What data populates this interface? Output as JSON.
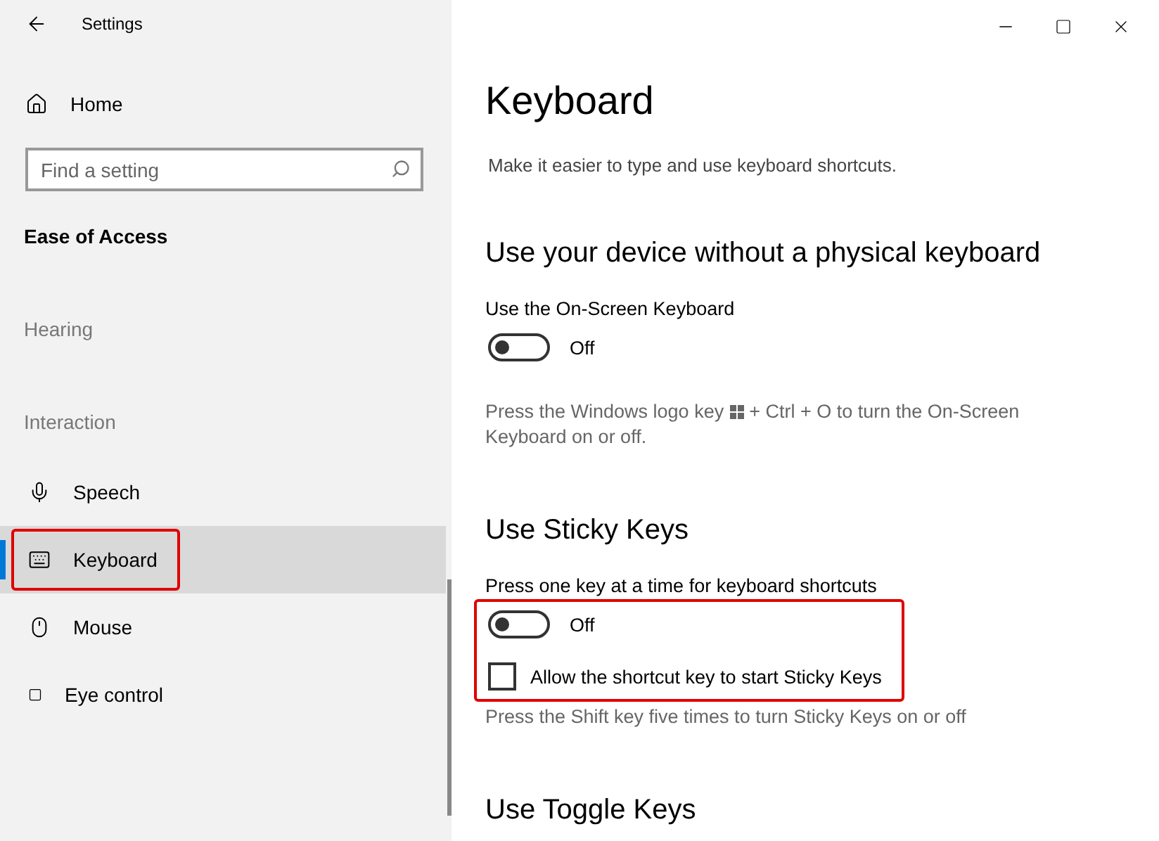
{
  "window": {
    "title": "Settings"
  },
  "sidebar": {
    "home": "Home",
    "search": {
      "placeholder": "Find a setting"
    },
    "section": "Ease of Access",
    "items": [
      {
        "kind": "header",
        "label": "Hearing"
      },
      {
        "kind": "header",
        "label": "Interaction"
      },
      {
        "kind": "item",
        "label": "Speech",
        "selected": false,
        "highlighted": false
      },
      {
        "kind": "item",
        "label": "Keyboard",
        "selected": true,
        "highlighted": true
      },
      {
        "kind": "item",
        "label": "Mouse",
        "selected": false,
        "highlighted": false
      },
      {
        "kind": "item",
        "label": "Eye control",
        "selected": false,
        "highlighted": false
      }
    ]
  },
  "page": {
    "title": "Keyboard",
    "subtitle": "Make it easier to type and use keyboard shortcuts.",
    "sections": [
      {
        "heading": "Use your device without a physical keyboard",
        "label": "Use the On-Screen Keyboard",
        "highlighted": false,
        "toggle": {
          "on": false,
          "text": "Off"
        },
        "help_before": "Press the Windows logo key",
        "help_after": "+ Ctrl + O to turn the On-Screen Keyboard on or off."
      },
      {
        "heading": "Use Sticky Keys",
        "label": "Press one key at a time for keyboard shortcuts",
        "highlighted": true,
        "toggle": {
          "on": false,
          "text": "Off"
        },
        "checkbox": {
          "label": "Allow the shortcut key to start Sticky Keys",
          "checked": false
        },
        "help_after": "Press the Shift key five times to turn Sticky Keys on or off"
      },
      {
        "heading": "Use Toggle Keys"
      }
    ]
  }
}
